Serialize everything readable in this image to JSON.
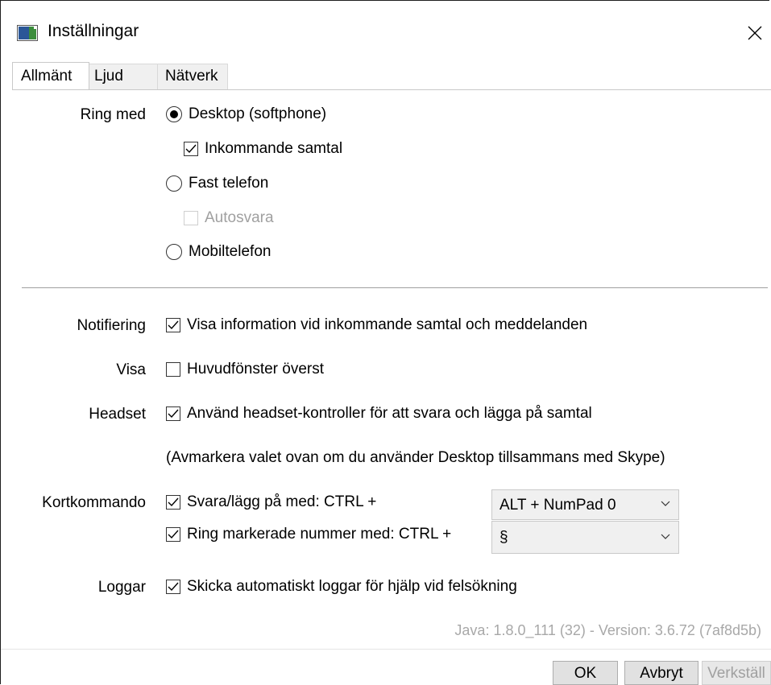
{
  "window": {
    "title": "Inställningar"
  },
  "tabs": [
    {
      "label": "Allmänt",
      "active": true
    },
    {
      "label": "Ljud",
      "active": false
    },
    {
      "label": "Nätverk",
      "active": false
    }
  ],
  "ring": {
    "label": "Ring med",
    "desktop": {
      "label": "Desktop (softphone)",
      "selected": true
    },
    "incoming": {
      "label": "Inkommande samtal",
      "checked": true
    },
    "fixed": {
      "label": "Fast telefon",
      "selected": false
    },
    "autoanswer": {
      "label": "Autosvara",
      "checked": false,
      "disabled": true
    },
    "mobile": {
      "label": "Mobiltelefon",
      "selected": false
    }
  },
  "notify": {
    "label": "Notifiering",
    "option": "Visa information vid inkommande samtal och meddelanden",
    "checked": true
  },
  "show": {
    "label": "Visa",
    "option": "Huvudfönster överst",
    "checked": false
  },
  "headset": {
    "label": "Headset",
    "option": "Använd headset-kontroller för att svara och lägga på samtal",
    "checked": true,
    "note": "(Avmarkera valet ovan om du använder Desktop tillsammans med Skype)"
  },
  "shortcuts": {
    "label": "Kortkommando",
    "answer": {
      "label": "Svara/lägg på med: CTRL +",
      "checked": true,
      "value": "ALT + NumPad 0"
    },
    "call": {
      "label": "Ring markerade nummer med: CTRL +",
      "checked": true,
      "value": "§"
    }
  },
  "logs": {
    "label": "Loggar",
    "option": "Skicka automatiskt loggar för hjälp vid felsökning",
    "checked": true
  },
  "version": "Java: 1.8.0_111 (32) - Version: 3.6.72 (7af8d5b)",
  "buttons": {
    "ok": "OK",
    "cancel": "Avbryt",
    "apply": "Verkställ"
  }
}
